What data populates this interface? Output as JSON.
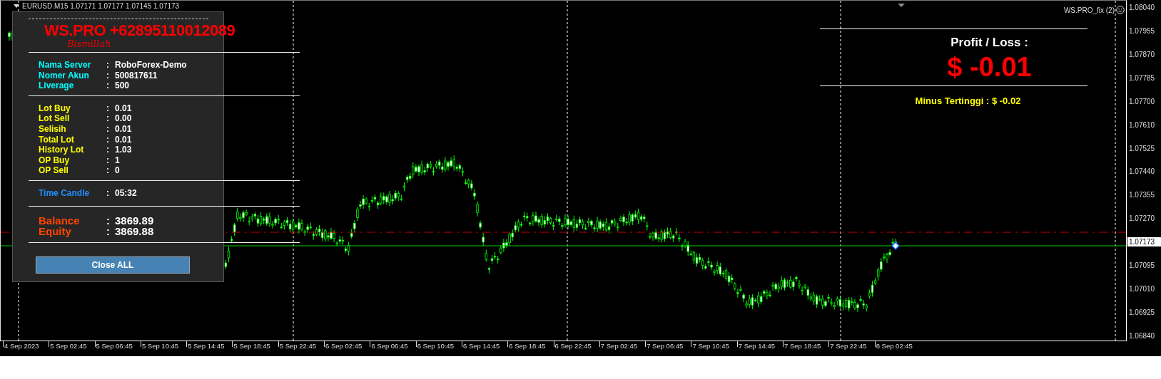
{
  "chart_label": "EURUSD.M15 1.07171 1.07177 1.07145 1.07173",
  "indicator_label": "WS.PRO_fix (2)",
  "panel": {
    "title": "WS.PRO +62895110012089",
    "subtitle": "Bismillah",
    "sections": [
      {
        "kind": "account",
        "rows": [
          {
            "label": "Nama Server",
            "sep": ":",
            "value": "RoboForex-Demo"
          },
          {
            "label": "Nomer Akun",
            "sep": ":",
            "value": "500817611"
          },
          {
            "label": "Liverage",
            "sep": ":",
            "value": "500"
          }
        ]
      },
      {
        "kind": "lots",
        "rows": [
          {
            "label": "Lot Buy",
            "sep": ":",
            "value": "0.01"
          },
          {
            "label": "Lot Sell",
            "sep": ":",
            "value": "0.00"
          },
          {
            "label": "Selisih",
            "sep": ":",
            "value": "0.01"
          },
          {
            "label": "Total Lot",
            "sep": ":",
            "value": "0.01"
          },
          {
            "label": "History Lot",
            "sep": ":",
            "value": "1.03"
          },
          {
            "label": "OP Buy",
            "sep": ":",
            "value": "1"
          },
          {
            "label": "OP Sell",
            "sep": ":",
            "value": "0"
          }
        ]
      },
      {
        "kind": "timer",
        "rows": [
          {
            "label": "Time Candle",
            "sep": ":",
            "value": "05:32"
          }
        ]
      },
      {
        "kind": "balance",
        "rows": [
          {
            "label": "Balance",
            "sep": ":",
            "value": "3869.89"
          },
          {
            "label": "Equity",
            "sep": ":",
            "value": "3869.88"
          }
        ]
      }
    ],
    "button": "Close ALL"
  },
  "profit": {
    "heading": "Profit / Loss :",
    "value": "$ -0.01",
    "minus": "Minus Tertinggi  : $ -0.02"
  },
  "price_axis": [
    {
      "label": "1.08040",
      "current": false
    },
    {
      "label": "1.07955",
      "current": false
    },
    {
      "label": "1.07870",
      "current": false
    },
    {
      "label": "1.07785",
      "current": false
    },
    {
      "label": "1.07700",
      "current": false
    },
    {
      "label": "1.07610",
      "current": false
    },
    {
      "label": "1.07525",
      "current": false
    },
    {
      "label": "1.07440",
      "current": false
    },
    {
      "label": "1.07355",
      "current": false
    },
    {
      "label": "1.07270",
      "current": false
    },
    {
      "label": "1.07173",
      "current": true
    },
    {
      "label": "1.07095",
      "current": false
    },
    {
      "label": "1.07010",
      "current": false
    },
    {
      "label": "1.06925",
      "current": false
    },
    {
      "label": "1.06840",
      "current": false
    }
  ],
  "time_axis": [
    "4 Sep 2023",
    "5 Sep 02:45",
    "5 Sep 06:45",
    "5 Sep 10:45",
    "5 Sep 14:45",
    "5 Sep 18:45",
    "5 Sep 22:45",
    "6 Sep 02:45",
    "6 Sep 06:45",
    "6 Sep 10:45",
    "6 Sep 14:45",
    "6 Sep 18:45",
    "6 Sep 22:45",
    "7 Sep 02:45",
    "7 Sep 06:45",
    "7 Sep 10:45",
    "7 Sep 14:45",
    "7 Sep 18:45",
    "7 Sep 22:45",
    "8 Sep 02:45"
  ]
}
